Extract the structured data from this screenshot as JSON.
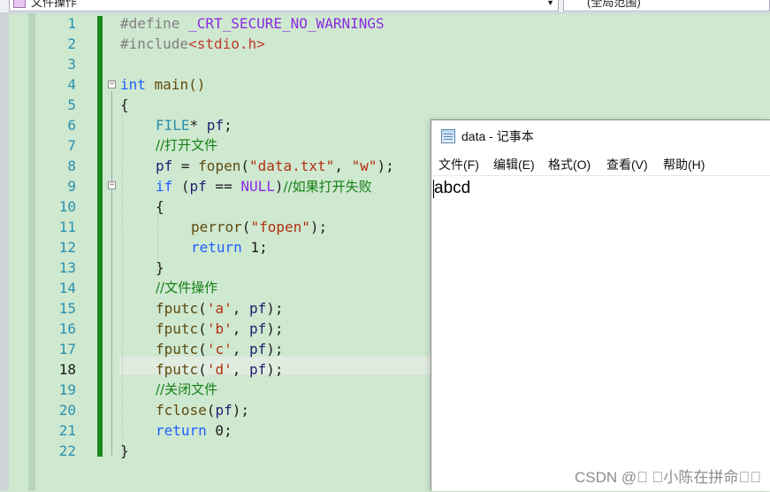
{
  "top_bar": {
    "scope_label": "文件操作",
    "scope_right": "(全局范围)"
  },
  "editor": {
    "current_line": 18,
    "lines": [
      {
        "n": "1"
      },
      {
        "n": "2"
      },
      {
        "n": "3"
      },
      {
        "n": "4"
      },
      {
        "n": "5"
      },
      {
        "n": "6"
      },
      {
        "n": "7"
      },
      {
        "n": "8"
      },
      {
        "n": "9"
      },
      {
        "n": "10"
      },
      {
        "n": "11"
      },
      {
        "n": "12"
      },
      {
        "n": "13"
      },
      {
        "n": "14"
      },
      {
        "n": "15"
      },
      {
        "n": "16"
      },
      {
        "n": "17"
      },
      {
        "n": "18"
      },
      {
        "n": "19"
      },
      {
        "n": "20"
      },
      {
        "n": "21"
      },
      {
        "n": "22"
      }
    ],
    "code": {
      "l1a": "#define ",
      "l1b": "_CRT_SECURE_NO_WARNINGS",
      "l2a": "#include",
      "l2b": "<stdio.h>",
      "l4a": "int",
      "l4b": " main()",
      "l5": "{",
      "l6a": "FILE",
      "l6b": "* ",
      "l6c": "pf",
      "l6d": ";",
      "l7": "//打开文件",
      "l8a": "pf",
      "l8b": " = ",
      "l8c": "fopen",
      "l8d": "(",
      "l8e": "\"data.txt\"",
      "l8f": ", ",
      "l8g": "\"w\"",
      "l8h": ");",
      "l9a": "if",
      "l9b": " (",
      "l9c": "pf",
      "l9d": " == ",
      "l9e": "NULL",
      "l9f": ")",
      "l9g": "//如果打开失败",
      "l10": "{",
      "l11a": "perror",
      "l11b": "(",
      "l11c": "\"fopen\"",
      "l11d": ");",
      "l12a": "return",
      "l12b": " 1;",
      "l13": "}",
      "l14": "//文件操作",
      "l15a": "fputc",
      "l15b": "(",
      "l15c": "'a'",
      "l15d": ", ",
      "l15e": "pf",
      "l15f": ");",
      "l16a": "fputc",
      "l16b": "(",
      "l16c": "'b'",
      "l16d": ", ",
      "l16e": "pf",
      "l16f": ");",
      "l17a": "fputc",
      "l17b": "(",
      "l17c": "'c'",
      "l17d": ", ",
      "l17e": "pf",
      "l17f": ");",
      "l18a": "fputc",
      "l18b": "(",
      "l18c": "'d'",
      "l18d": ", ",
      "l18e": "pf",
      "l18f": ");",
      "l19": "//关闭文件",
      "l20a": "fclose",
      "l20b": "(",
      "l20c": "pf",
      "l20d": ");",
      "l21a": "return",
      "l21b": " 0;",
      "l22": "}"
    }
  },
  "notepad": {
    "title": "data - 记事本",
    "menu": [
      "文件(F)",
      "编辑(E)",
      "格式(O)",
      "查看(V)",
      "帮助(H)"
    ],
    "content": "abcd"
  },
  "watermark": "CSDN @\u0000 \u0000小陈在拼命\u0000\u0000"
}
